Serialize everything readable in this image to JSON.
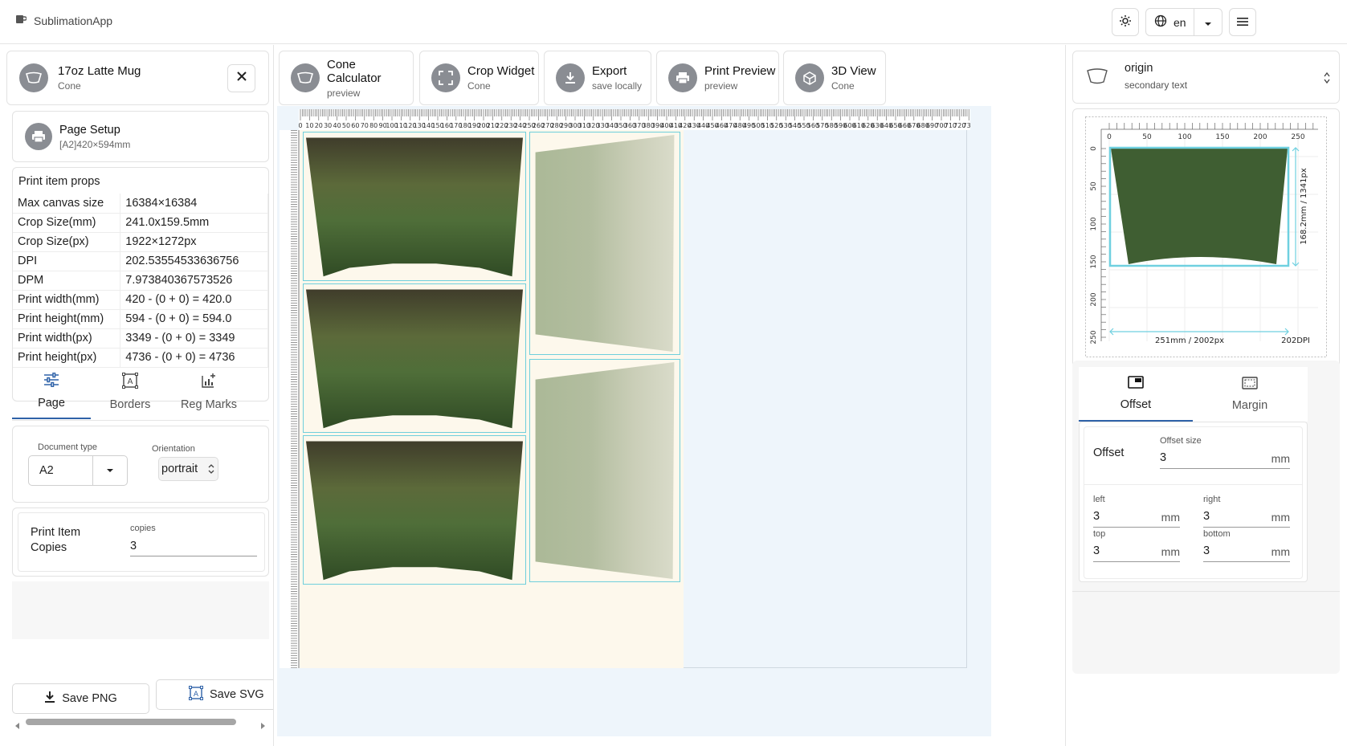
{
  "app": {
    "title": "SublimationApp",
    "language": "en"
  },
  "left": {
    "product": {
      "title": "17oz Latte Mug",
      "subtitle": "Cone"
    },
    "page_setup": {
      "title": "Page Setup",
      "subtitle": "[A2]420×594mm"
    },
    "props": {
      "heading": "Print item props",
      "rows": [
        {
          "k": "Max canvas size",
          "v": "16384×16384"
        },
        {
          "k": "Crop Size(mm)",
          "v": "241.0x159.5mm"
        },
        {
          "k": "Crop Size(px)",
          "v": "1922×1272px"
        },
        {
          "k": "DPI",
          "v": "202.53554533636756"
        },
        {
          "k": "DPM",
          "v": "7.973840367573526"
        },
        {
          "k": "Print width(mm)",
          "v": "420 - (0 + 0) = 420.0"
        },
        {
          "k": "Print height(mm)",
          "v": "594 - (0 + 0) = 594.0"
        },
        {
          "k": "Print width(px)",
          "v": "3349 - (0 + 0) = 3349"
        },
        {
          "k": "Print height(px)",
          "v": "4736 - (0 + 0) = 4736"
        }
      ]
    },
    "tabs": [
      {
        "label": "Page"
      },
      {
        "label": "Borders"
      },
      {
        "label": "Reg Marks"
      }
    ],
    "document_type": {
      "label": "Document type",
      "value": "A2"
    },
    "orientation": {
      "label": "Orientation",
      "value": "portrait"
    },
    "copies": {
      "label1": "Print Item",
      "label2": "Copies",
      "field_label": "copies",
      "value": "3"
    },
    "save_png": "Save PNG",
    "save_svg": "Save SVG"
  },
  "toolbar": [
    {
      "title": "Cone Calculator",
      "sub": "preview"
    },
    {
      "title": "Crop Widget",
      "sub": "Cone"
    },
    {
      "title": "Export",
      "sub": "save locally"
    },
    {
      "title": "Print Preview",
      "sub": "preview"
    },
    {
      "title": "3D View",
      "sub": "Cone"
    }
  ],
  "ruler": {
    "top_labels": [
      "0",
      "10",
      "20",
      "30",
      "40",
      "50",
      "60",
      "70",
      "80",
      "90",
      "100",
      "110",
      "120",
      "130",
      "140",
      "150",
      "160",
      "170",
      "180",
      "190",
      "200",
      "210",
      "220",
      "230",
      "240",
      "250",
      "260",
      "270",
      "280",
      "290",
      "300",
      "310",
      "320",
      "330",
      "340",
      "350",
      "360",
      "370",
      "380",
      "390",
      "400",
      "410",
      "420",
      "430",
      "440",
      "450",
      "460",
      "470",
      "480",
      "490",
      "500",
      "510",
      "520",
      "530",
      "540",
      "550",
      "560",
      "570",
      "580",
      "590",
      "600",
      "610",
      "620",
      "630",
      "640",
      "650",
      "660",
      "670",
      "680",
      "690",
      "700",
      "710",
      "720",
      "730"
    ]
  },
  "right": {
    "origin": {
      "title": "origin",
      "sub": "secondary text"
    },
    "preview": {
      "x_ticks": [
        "0",
        "50",
        "100",
        "150",
        "200",
        "250"
      ],
      "y_ticks": [
        "0",
        "50",
        "100",
        "150",
        "200",
        "250"
      ],
      "height_label": "168.2mm / 1341px",
      "width_label": "251mm / 2002px",
      "dpi_label": "202DPI"
    },
    "tabs": [
      {
        "label": "Offset"
      },
      {
        "label": "Margin"
      }
    ],
    "offset": {
      "title": "Offset",
      "size_label": "Offset size",
      "size_value": "3",
      "unit": "mm",
      "left_label": "left",
      "left_value": "3",
      "right_label": "right",
      "right_value": "3",
      "top_label": "top",
      "top_value": "3",
      "bottom_label": "bottom",
      "bottom_value": "3"
    }
  }
}
